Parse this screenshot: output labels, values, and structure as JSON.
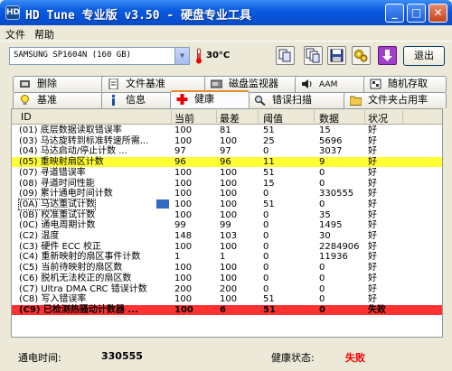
{
  "window": {
    "title": "HD Tune 专业版 v3.50 - 硬盘专业工具",
    "icon_letters": "HD"
  },
  "menu": [
    "文件",
    "帮助"
  ],
  "toolbar": {
    "drive": "SAMSUNG SP1604N (160 GB)",
    "temperature": "30°C",
    "exit_label": "退出"
  },
  "tabs_row1": [
    {
      "label": "删除",
      "icon": "eraser-icon"
    },
    {
      "label": "文件基准",
      "icon": "document-icon"
    },
    {
      "label": "磁盘监视器",
      "icon": "disk-monitor-icon"
    },
    {
      "label": "AAM",
      "icon": "speaker-icon"
    },
    {
      "label": "随机存取",
      "icon": "random-access-icon"
    }
  ],
  "tabs_row2": [
    {
      "label": "基准",
      "icon": "lightbulb-icon"
    },
    {
      "label": "信息",
      "icon": "info-icon"
    },
    {
      "label": "健康",
      "icon": "red-cross-icon",
      "active": true
    },
    {
      "label": "错误扫描",
      "icon": "magnifier-icon"
    },
    {
      "label": "文件夹占用率",
      "icon": "folder-icon"
    }
  ],
  "table": {
    "headers": [
      "ID",
      "当前",
      "最差",
      "阈值",
      "数据",
      "状况"
    ],
    "rows": [
      {
        "id": "(01) 底层数据读取错误率",
        "cur": "100",
        "worst": "81",
        "thr": "51",
        "data": "15",
        "status": "好"
      },
      {
        "id": "(03) 马达旋转到标准转速所需...",
        "cur": "100",
        "worst": "100",
        "thr": "25",
        "data": "5696",
        "status": "好"
      },
      {
        "id": "(04) 马达启动/停止计数   ...",
        "cur": "97",
        "worst": "97",
        "thr": "0",
        "data": "3037",
        "status": "好"
      },
      {
        "id": "(05) 重映射扇区计数",
        "cur": "96",
        "worst": "96",
        "thr": "11",
        "data": "9",
        "status": "好",
        "hl": "yellow"
      },
      {
        "id": "(07) 寻道错误率",
        "cur": "100",
        "worst": "100",
        "thr": "51",
        "data": "0",
        "status": "好"
      },
      {
        "id": "(08) 寻道时间性能",
        "cur": "100",
        "worst": "100",
        "thr": "15",
        "data": "0",
        "status": "好"
      },
      {
        "id": "(09) 累计通电时间计数",
        "cur": "100",
        "worst": "100",
        "thr": "0",
        "data": "330555",
        "status": "好"
      },
      {
        "id": "(0A) 马达重试计数",
        "cur": "100",
        "worst": "100",
        "thr": "51",
        "data": "0",
        "status": "好",
        "focus": true
      },
      {
        "id": "(0B) 校准重试计数",
        "cur": "100",
        "worst": "100",
        "thr": "0",
        "data": "35",
        "status": "好"
      },
      {
        "id": "(0C) 通电周期计数",
        "cur": "99",
        "worst": "99",
        "thr": "0",
        "data": "1495",
        "status": "好"
      },
      {
        "id": "(C2) 温度",
        "cur": "148",
        "worst": "103",
        "thr": "0",
        "data": "30",
        "status": "好"
      },
      {
        "id": "(C3) 硬件 ECC 校正",
        "cur": "100",
        "worst": "100",
        "thr": "0",
        "data": "2284906",
        "status": "好"
      },
      {
        "id": "(C4) 重新映射的扇区事件计数",
        "cur": "1",
        "worst": "1",
        "thr": "0",
        "data": "11936",
        "status": "好"
      },
      {
        "id": "(C5) 当前待映射的扇区数",
        "cur": "100",
        "worst": "100",
        "thr": "0",
        "data": "0",
        "status": "好"
      },
      {
        "id": "(C6) 脱机无法校正的扇区数",
        "cur": "100",
        "worst": "100",
        "thr": "0",
        "data": "0",
        "status": "好"
      },
      {
        "id": "(C7) Ultra DMA CRC 错误计数",
        "cur": "200",
        "worst": "200",
        "thr": "0",
        "data": "0",
        "status": "好"
      },
      {
        "id": "(C8) 写入错误率",
        "cur": "100",
        "worst": "100",
        "thr": "51",
        "data": "0",
        "status": "好"
      },
      {
        "id": "(C9) 已检测热骚动计数器  ...",
        "cur": "100",
        "worst": "6",
        "thr": "51",
        "data": "0",
        "status": "失败",
        "hl": "red"
      }
    ]
  },
  "status": {
    "power_on_label": "通电时间:",
    "power_on_value": "330555",
    "health_label": "健康状态:",
    "health_value": "失败"
  }
}
